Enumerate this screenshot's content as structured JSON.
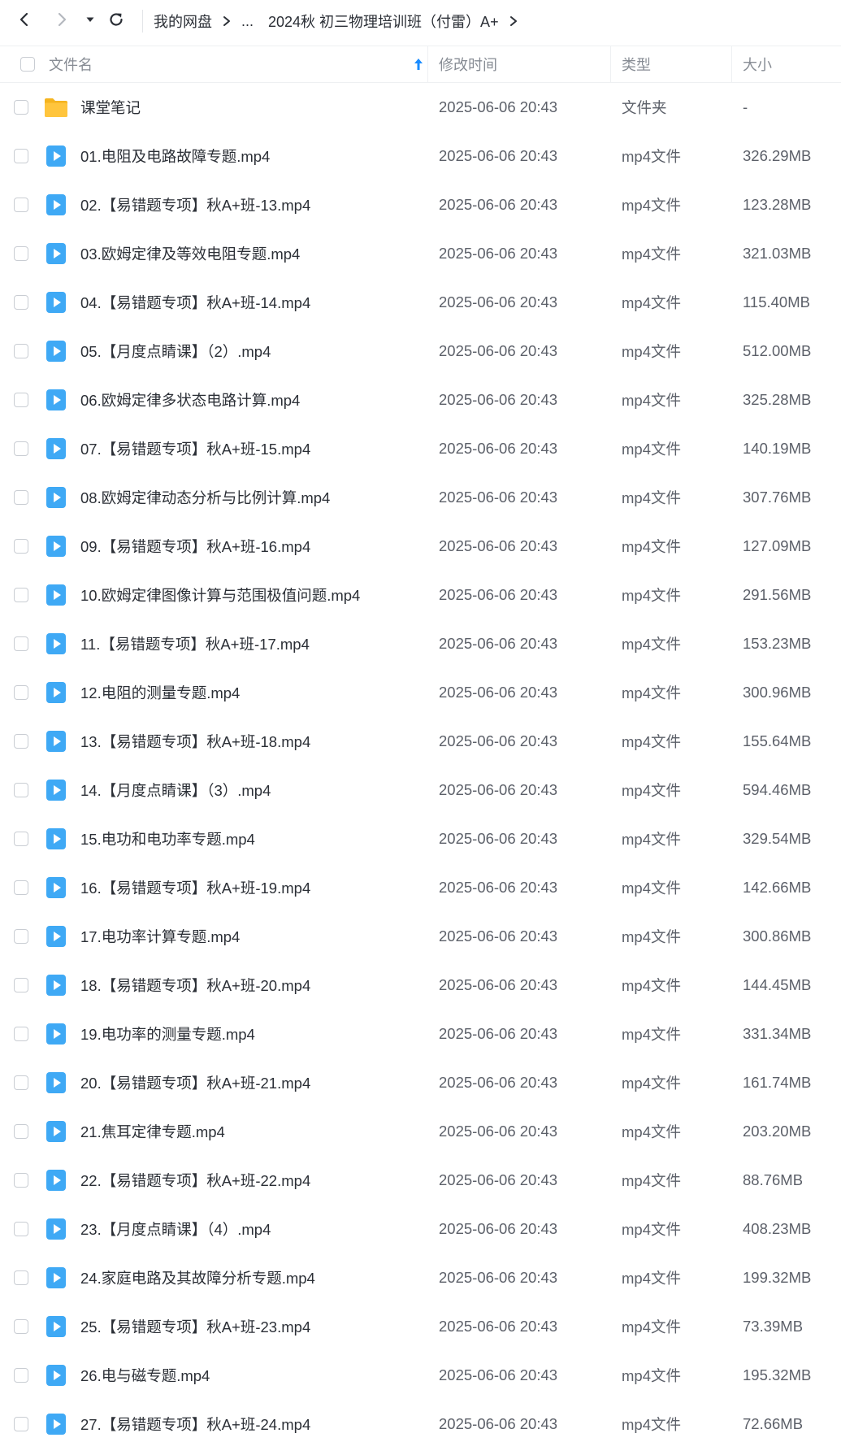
{
  "nav": {
    "back_icon": "chevron-left-icon",
    "forward_icon": "chevron-right-icon",
    "dropdown_icon": "caret-down-icon",
    "refresh_icon": "refresh-icon"
  },
  "breadcrumb": {
    "root": "我的网盘",
    "ellipsis": "...",
    "current": "2024秋 初三物理培训班（付雷）A+"
  },
  "header": {
    "name": "文件名",
    "modified": "修改时间",
    "type": "类型",
    "size": "大小",
    "sort_icon": "sort-up-arrow-icon"
  },
  "colors": {
    "accent": "#1a8cff",
    "video_icon": "#3fa9f5",
    "folder_icon": "#ffc53d"
  },
  "files": [
    {
      "name": "课堂笔记",
      "modified": "2025-06-06 20:43",
      "type": "文件夹",
      "size": "-",
      "icon": "folder-icon"
    },
    {
      "name": "01.电阻及电路故障专题.mp4",
      "modified": "2025-06-06 20:43",
      "type": "mp4文件",
      "size": "326.29MB",
      "icon": "video-file-icon"
    },
    {
      "name": "02.【易错题专项】秋A+班-13.mp4",
      "modified": "2025-06-06 20:43",
      "type": "mp4文件",
      "size": "123.28MB",
      "icon": "video-file-icon"
    },
    {
      "name": "03.欧姆定律及等效电阻专题.mp4",
      "modified": "2025-06-06 20:43",
      "type": "mp4文件",
      "size": "321.03MB",
      "icon": "video-file-icon"
    },
    {
      "name": "04.【易错题专项】秋A+班-14.mp4",
      "modified": "2025-06-06 20:43",
      "type": "mp4文件",
      "size": "115.40MB",
      "icon": "video-file-icon"
    },
    {
      "name": "05.【月度点睛课】（2）.mp4",
      "modified": "2025-06-06 20:43",
      "type": "mp4文件",
      "size": "512.00MB",
      "icon": "video-file-icon"
    },
    {
      "name": "06.欧姆定律多状态电路计算.mp4",
      "modified": "2025-06-06 20:43",
      "type": "mp4文件",
      "size": "325.28MB",
      "icon": "video-file-icon"
    },
    {
      "name": "07.【易错题专项】秋A+班-15.mp4",
      "modified": "2025-06-06 20:43",
      "type": "mp4文件",
      "size": "140.19MB",
      "icon": "video-file-icon"
    },
    {
      "name": "08.欧姆定律动态分析与比例计算.mp4",
      "modified": "2025-06-06 20:43",
      "type": "mp4文件",
      "size": "307.76MB",
      "icon": "video-file-icon"
    },
    {
      "name": "09.【易错题专项】秋A+班-16.mp4",
      "modified": "2025-06-06 20:43",
      "type": "mp4文件",
      "size": "127.09MB",
      "icon": "video-file-icon"
    },
    {
      "name": "10.欧姆定律图像计算与范围极值问题.mp4",
      "modified": "2025-06-06 20:43",
      "type": "mp4文件",
      "size": "291.56MB",
      "icon": "video-file-icon"
    },
    {
      "name": "11.【易错题专项】秋A+班-17.mp4",
      "modified": "2025-06-06 20:43",
      "type": "mp4文件",
      "size": "153.23MB",
      "icon": "video-file-icon"
    },
    {
      "name": "12.电阻的测量专题.mp4",
      "modified": "2025-06-06 20:43",
      "type": "mp4文件",
      "size": "300.96MB",
      "icon": "video-file-icon"
    },
    {
      "name": "13.【易错题专项】秋A+班-18.mp4",
      "modified": "2025-06-06 20:43",
      "type": "mp4文件",
      "size": "155.64MB",
      "icon": "video-file-icon"
    },
    {
      "name": "14.【月度点睛课】（3）.mp4",
      "modified": "2025-06-06 20:43",
      "type": "mp4文件",
      "size": "594.46MB",
      "icon": "video-file-icon"
    },
    {
      "name": "15.电功和电功率专题.mp4",
      "modified": "2025-06-06 20:43",
      "type": "mp4文件",
      "size": "329.54MB",
      "icon": "video-file-icon"
    },
    {
      "name": "16.【易错题专项】秋A+班-19.mp4",
      "modified": "2025-06-06 20:43",
      "type": "mp4文件",
      "size": "142.66MB",
      "icon": "video-file-icon"
    },
    {
      "name": "17.电功率计算专题.mp4",
      "modified": "2025-06-06 20:43",
      "type": "mp4文件",
      "size": "300.86MB",
      "icon": "video-file-icon"
    },
    {
      "name": "18.【易错题专项】秋A+班-20.mp4",
      "modified": "2025-06-06 20:43",
      "type": "mp4文件",
      "size": "144.45MB",
      "icon": "video-file-icon"
    },
    {
      "name": "19.电功率的测量专题.mp4",
      "modified": "2025-06-06 20:43",
      "type": "mp4文件",
      "size": "331.34MB",
      "icon": "video-file-icon"
    },
    {
      "name": "20.【易错题专项】秋A+班-21.mp4",
      "modified": "2025-06-06 20:43",
      "type": "mp4文件",
      "size": "161.74MB",
      "icon": "video-file-icon"
    },
    {
      "name": "21.焦耳定律专题.mp4",
      "modified": "2025-06-06 20:43",
      "type": "mp4文件",
      "size": "203.20MB",
      "icon": "video-file-icon"
    },
    {
      "name": "22.【易错题专项】秋A+班-22.mp4",
      "modified": "2025-06-06 20:43",
      "type": "mp4文件",
      "size": "88.76MB",
      "icon": "video-file-icon"
    },
    {
      "name": "23.【月度点睛课】（4）.mp4",
      "modified": "2025-06-06 20:43",
      "type": "mp4文件",
      "size": "408.23MB",
      "icon": "video-file-icon"
    },
    {
      "name": "24.家庭电路及其故障分析专题.mp4",
      "modified": "2025-06-06 20:43",
      "type": "mp4文件",
      "size": "199.32MB",
      "icon": "video-file-icon"
    },
    {
      "name": "25.【易错题专项】秋A+班-23.mp4",
      "modified": "2025-06-06 20:43",
      "type": "mp4文件",
      "size": "73.39MB",
      "icon": "video-file-icon"
    },
    {
      "name": "26.电与磁专题.mp4",
      "modified": "2025-06-06 20:43",
      "type": "mp4文件",
      "size": "195.32MB",
      "icon": "video-file-icon"
    },
    {
      "name": "27.【易错题专项】秋A+班-24.mp4",
      "modified": "2025-06-06 20:43",
      "type": "mp4文件",
      "size": "72.66MB",
      "icon": "video-file-icon"
    }
  ]
}
